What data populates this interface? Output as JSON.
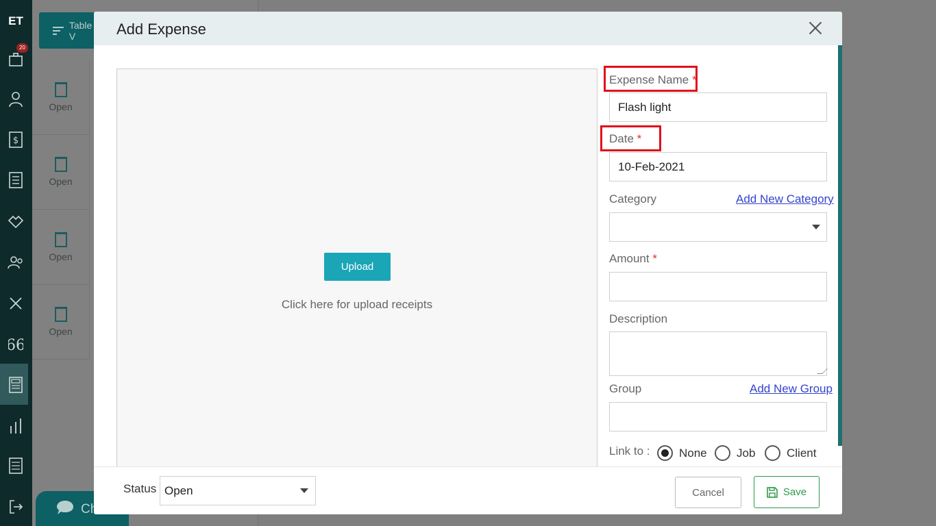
{
  "background": {
    "logo": "ET",
    "notification_count": "20",
    "table_view_label": "Table V",
    "row_status": [
      "Open",
      "Open",
      "Open",
      "Open"
    ],
    "chat_label": "Ch"
  },
  "modal": {
    "title": "Add Expense",
    "upload": {
      "button_label": "Upload",
      "hint": "Click here for upload receipts"
    },
    "form": {
      "expense_name_label": "Expense Name",
      "expense_name_value": "Flash light",
      "date_label": "Date",
      "date_value": "10-Feb-2021",
      "category_label": "Category",
      "add_category_link": "Add New Category",
      "category_value": "",
      "amount_label": "Amount",
      "amount_value": "",
      "description_label": "Description",
      "group_label": "Group",
      "add_group_link": "Add New Group",
      "group_value": "",
      "link_to_label": "Link to :",
      "link_options": [
        "None",
        "Job",
        "Client"
      ],
      "link_selected": "None",
      "required_marker": "*"
    },
    "footer": {
      "status_label": "Status",
      "status_value": "Open",
      "cancel_label": "Cancel",
      "save_label": "Save"
    }
  },
  "colors": {
    "sidebar": "#0f2a2b",
    "accent": "#1aa6b7",
    "save": "#2e9b4a",
    "highlight": "#e0101b",
    "link": "#3344cc"
  }
}
